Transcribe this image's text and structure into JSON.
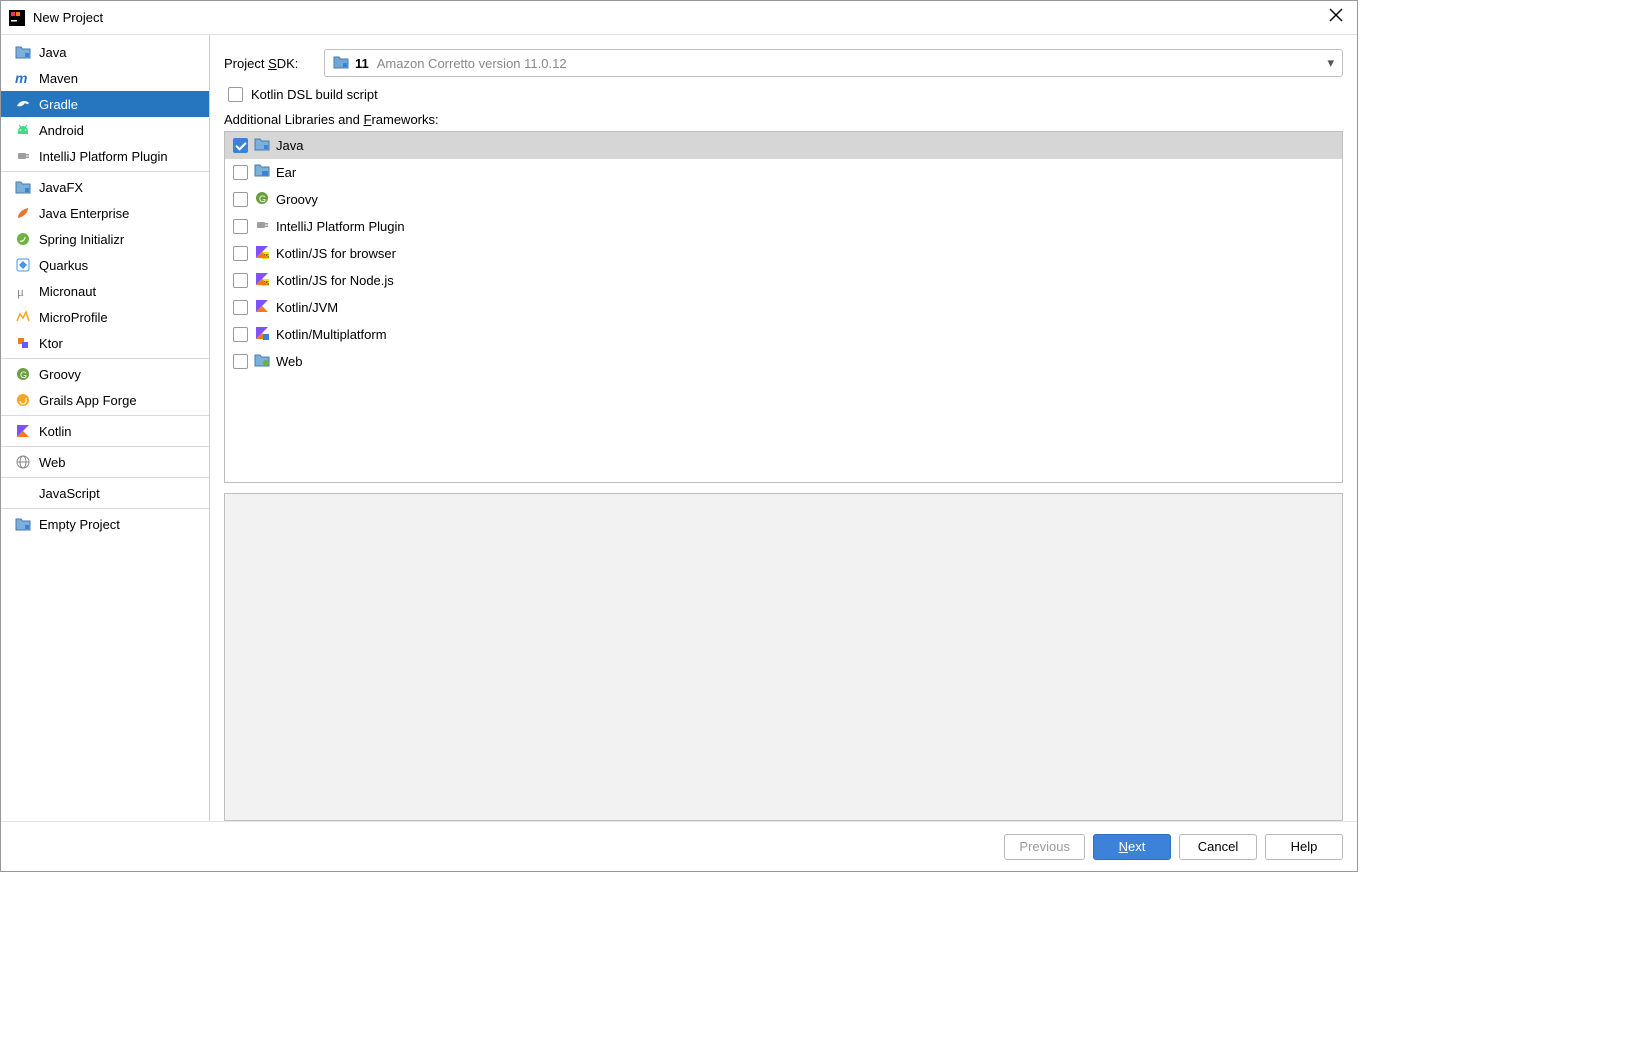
{
  "window": {
    "title": "New Project"
  },
  "sidebar": {
    "groups": [
      [
        "Java",
        "Maven",
        "Gradle",
        "Android",
        "IntelliJ Platform Plugin"
      ],
      [
        "JavaFX",
        "Java Enterprise",
        "Spring Initializr",
        "Quarkus",
        "Micronaut",
        "MicroProfile",
        "Ktor"
      ],
      [
        "Groovy",
        "Grails App Forge"
      ],
      [
        "Kotlin"
      ],
      [
        "Web"
      ],
      [
        "JavaScript"
      ],
      [
        "Empty Project"
      ]
    ],
    "selected": "Gradle"
  },
  "sdk": {
    "label_prefix": "Project ",
    "label_underlined": "S",
    "label_suffix": "DK:",
    "version": "11",
    "description": "Amazon Corretto version 11.0.12"
  },
  "kotlin_dsl": {
    "label": "Kotlin DSL build script",
    "checked": false
  },
  "frameworks_label_prefix": "Additional Libraries and ",
  "frameworks_label_underlined": "F",
  "frameworks_label_suffix": "rameworks:",
  "frameworks": [
    {
      "label": "Java",
      "checked": true,
      "selected": true,
      "icon": "folder"
    },
    {
      "label": "Ear",
      "checked": false,
      "icon": "ear"
    },
    {
      "label": "Groovy",
      "checked": false,
      "icon": "groovy"
    },
    {
      "label": "IntelliJ Platform Plugin",
      "checked": false,
      "icon": "plug"
    },
    {
      "label": "Kotlin/JS for browser",
      "checked": false,
      "icon": "kotlin-js"
    },
    {
      "label": "Kotlin/JS for Node.js",
      "checked": false,
      "icon": "kotlin-js"
    },
    {
      "label": "Kotlin/JVM",
      "checked": false,
      "icon": "kotlin"
    },
    {
      "label": "Kotlin/Multiplatform",
      "checked": false,
      "icon": "kotlin-mp"
    },
    {
      "label": "Web",
      "checked": false,
      "icon": "web"
    }
  ],
  "buttons": {
    "previous": "Previous",
    "next_underlined": "N",
    "next_rest": "ext",
    "cancel": "Cancel",
    "help": "Help"
  },
  "icons": {
    "Java": "folder",
    "Maven": "maven",
    "Gradle": "gradle",
    "Android": "android",
    "IntelliJ Platform Plugin": "plug",
    "JavaFX": "folder",
    "Java Enterprise": "leaf",
    "Spring Initializr": "spring",
    "Quarkus": "quarkus",
    "Micronaut": "micronaut",
    "MicroProfile": "microprofile",
    "Ktor": "ktor",
    "Groovy": "groovy",
    "Grails App Forge": "grails",
    "Kotlin": "kotlin",
    "Web": "globe",
    "JavaScript": "none",
    "Empty Project": "folder"
  }
}
